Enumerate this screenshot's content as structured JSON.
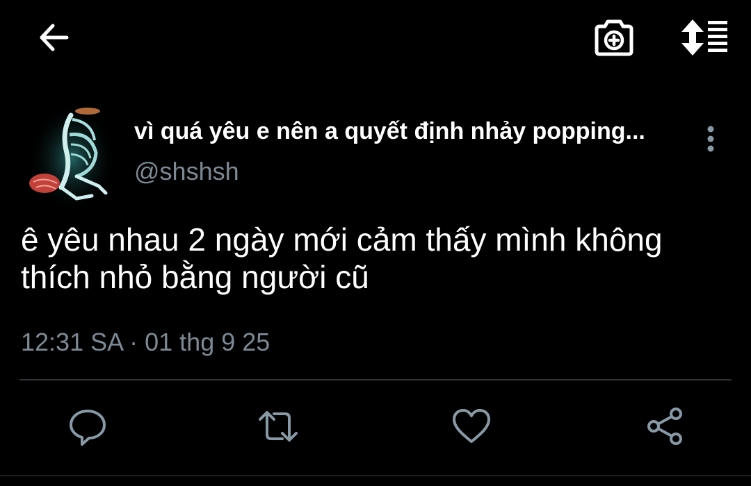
{
  "tweet": {
    "display_name": "vì quá yêu e nên a quyết định nhảy popping...",
    "handle": "@shshsh",
    "text_line1": "ê yêu nhau 2 ngày mới cảm thấy mình không",
    "text_line2": "thích nhỏ bằng người cũ",
    "timestamp": "12:31 SA · 01 thg 9 25"
  },
  "icons": {
    "back": "back-arrow-icon",
    "camera": "camera-plus-icon",
    "sort": "sort-list-icon",
    "more": "more-vertical-icon",
    "reply": "reply-icon",
    "retweet": "retweet-icon",
    "like": "heart-icon",
    "share": "share-icon"
  },
  "colors": {
    "background": "#000000",
    "text": "#ffffff",
    "secondary": "#7d8a95",
    "icon_gray": "#8899a6",
    "divider": "#2f3336"
  }
}
